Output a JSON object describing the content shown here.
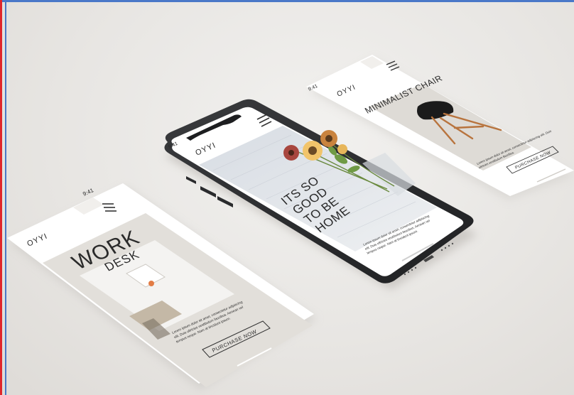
{
  "phone_left": {
    "status_time": "9:41",
    "logo": "OYYI",
    "headline_1": "WORK",
    "headline_2": "DESK",
    "body_text": "Lorem ipsum dolor sit amet, consectetur adipiscing elit. Duis ultricies vestibulum faucibus. Aenean vel tempus neque. Nam at tincidunt ipsum.",
    "cta": "PURCHASE NOW"
  },
  "phone_center": {
    "status_time": "9:41",
    "logo": "OYYI",
    "hero_line_1": "ITS SO",
    "hero_line_2": "GOOD",
    "hero_line_3": "TO BE",
    "hero_line_4": "HOME",
    "body_text": "Lorem ipsum dolor sit amet, consectetur adipiscing elit. Duis ultricies vestibulum faucibus. Aenean vel tempus neque. Nam at tincidunt ipsum."
  },
  "phone_right": {
    "status_time": "9:41",
    "logo": "OYYI",
    "headline": "MINIMALIST CHAIR",
    "body_text": "Lorem ipsum dolor sit amet, consectetur adipiscing elit. Duis ultricies vestibulum faucibus.",
    "cta": "PURCHASE NOW"
  },
  "colors": {
    "background": "#e9e7e4",
    "phone_frame": "#2b2c2e",
    "screen": "#ffffff",
    "card_tint": "#e4e1dc"
  },
  "icons": [
    "hamburger-menu-icon",
    "signal-icon",
    "battery-icon"
  ]
}
